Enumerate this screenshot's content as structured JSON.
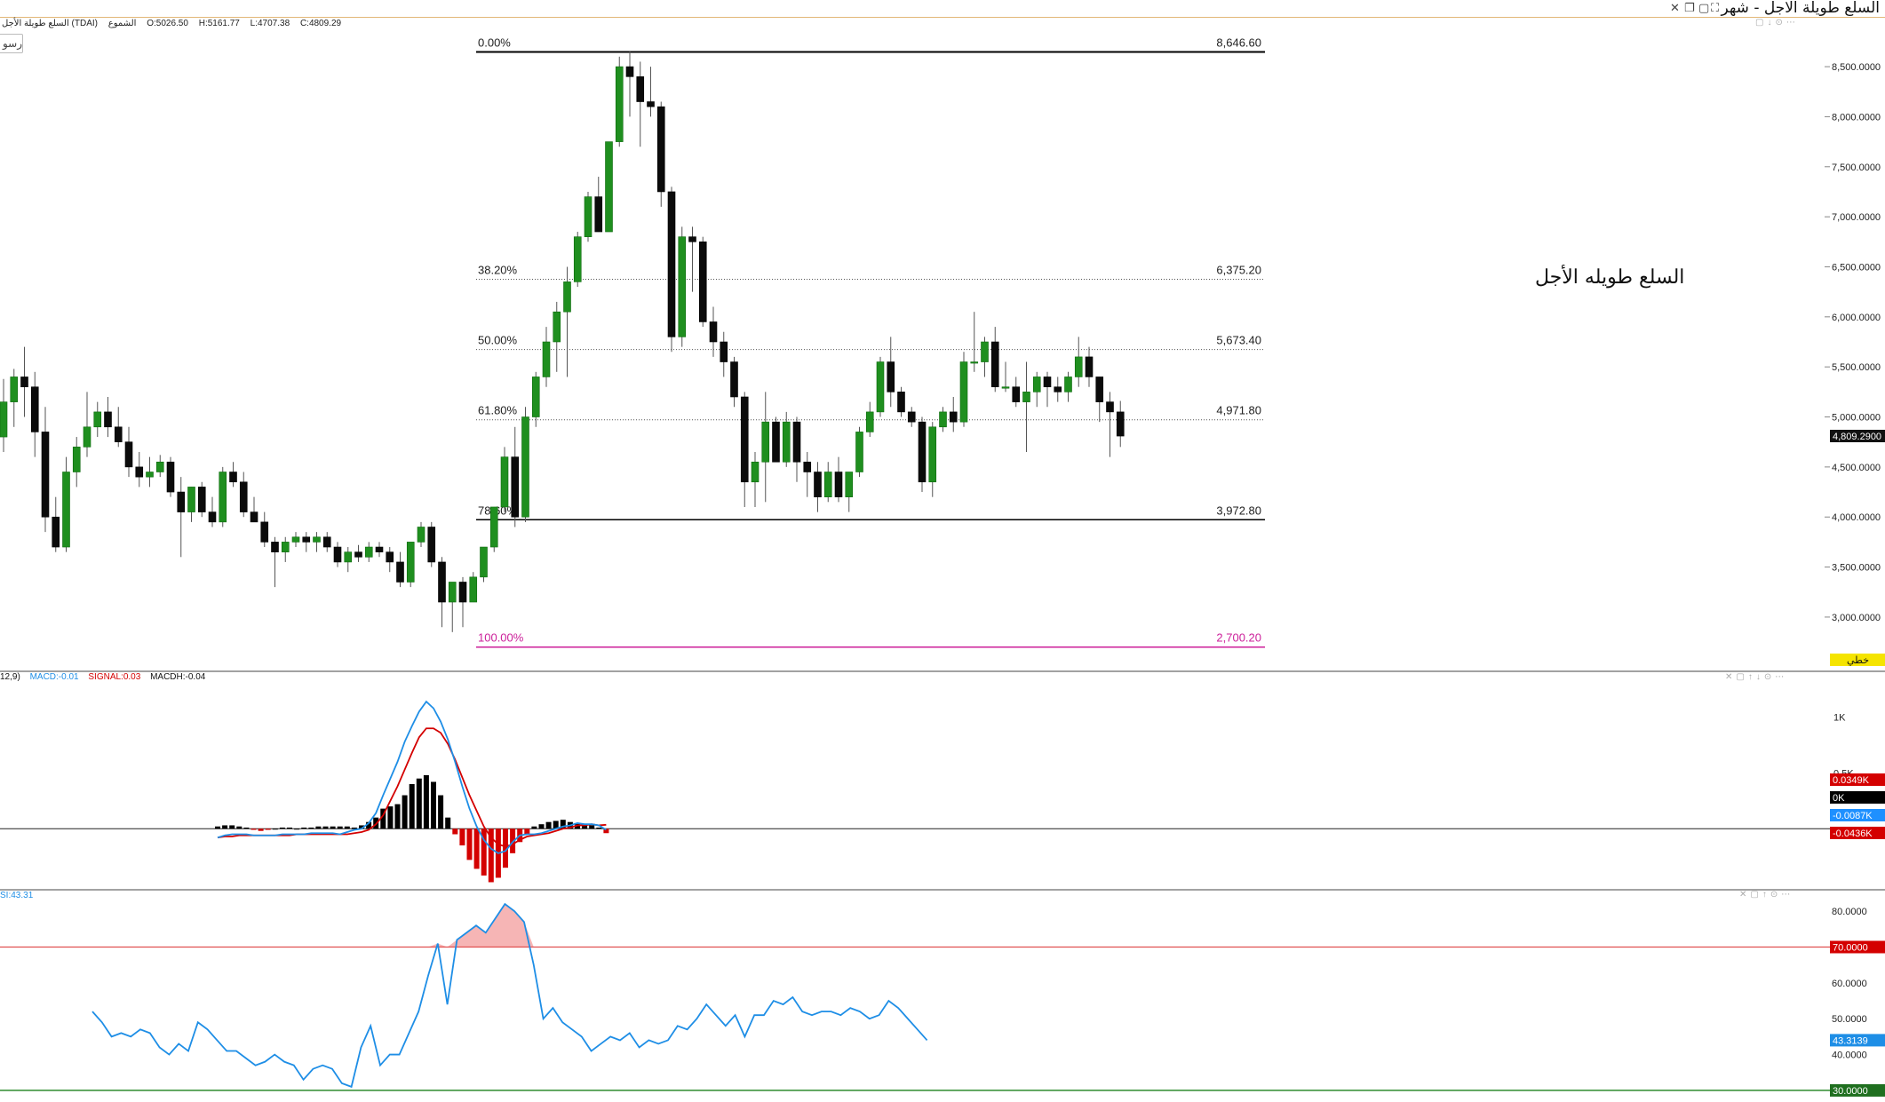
{
  "window": {
    "title": "السلع طويلة الاجل - شهر",
    "close_icon": "close-icon",
    "restore_icon": "restore-icon",
    "maximize_icon": "maximize-icon",
    "pin_icon": "pin-icon"
  },
  "ohlc": {
    "symbol": "السلع طويلة الأجل (TDAI)",
    "type": "الشموع",
    "open": "O:5026.50",
    "high": "H:5161.77",
    "low": "L:4707.38",
    "close": "C:4809.29"
  },
  "left_tab_label": "رسو",
  "note_text": "السلع طويله الأجل",
  "price_axis": {
    "ticks": [
      "8,500.0000",
      "8,000.0000",
      "7,500.0000",
      "7,000.0000",
      "6,500.0000",
      "6,000.0000",
      "5,500.0000",
      "5,000.0000",
      "4,500.0000",
      "4,000.0000",
      "3,500.0000",
      "3,000.0000"
    ],
    "last_price_label": "4,809.2900",
    "scale_badge": "خطي"
  },
  "fibonacci": {
    "levels": [
      {
        "pct": "0.00%",
        "value": "8,646.60",
        "price": 8646.6,
        "style": "solid",
        "color": "#000000"
      },
      {
        "pct": "38.20%",
        "value": "6,375.20",
        "price": 6375.2,
        "style": "dotted",
        "color": "#555555"
      },
      {
        "pct": "50.00%",
        "value": "5,673.40",
        "price": 5673.4,
        "style": "dotted",
        "color": "#555555"
      },
      {
        "pct": "61.80%",
        "value": "4,971.80",
        "price": 4971.8,
        "style": "dotted",
        "color": "#555555"
      },
      {
        "pct": "78.60%",
        "value": "3,972.80",
        "price": 3972.8,
        "style": "solid",
        "color": "#000000"
      },
      {
        "pct": "100.00%",
        "value": "2,700.20",
        "price": 2700.2,
        "style": "solid",
        "color": "#cc1f9a"
      }
    ]
  },
  "macd": {
    "legend_prefix": "12,9)",
    "macd_label": "MACD:-0.01",
    "signal_label": "SIGNAL:0.03",
    "hist_label": "MACDH:-0.04",
    "axis_ticks": [
      "1K",
      "0.5K"
    ],
    "badges": [
      {
        "text": "0.0349K",
        "color": "#d40000"
      },
      {
        "text": "0K",
        "color": "#000000"
      },
      {
        "text": "-0.0087K",
        "color": "#1e90ff"
      },
      {
        "text": "-0.0436K",
        "color": "#d40000"
      }
    ],
    "colors": {
      "macd": "#1e8ee6",
      "signal": "#d40000",
      "hist_pos": "#000000",
      "hist_neg": "#d40000"
    }
  },
  "rsi": {
    "legend_label": "SI:43.31",
    "axis_ticks": [
      "80.0000",
      "60.0000",
      "50.0000",
      "40.0000"
    ],
    "overbought_label": "70.0000",
    "oversold_label": "30.0000",
    "last_label": "43.3139",
    "colors": {
      "line": "#1e8ee6",
      "overbought": "#e05050",
      "oversold": "#2e8b2e",
      "fill": "#f4a8a8"
    }
  },
  "chart_data": [
    {
      "type": "candlestick",
      "title": "السلع طويلة الاجل - شهر",
      "xlabel": "",
      "ylabel": "",
      "ylim": [
        2600,
        8900
      ],
      "grid": false,
      "candles": [
        [
          4800,
          5380,
          4650,
          5150
        ],
        [
          5150,
          5480,
          4900,
          5400
        ],
        [
          5400,
          5700,
          5000,
          5300
        ],
        [
          5300,
          5450,
          4600,
          4850
        ],
        [
          4850,
          5100,
          3850,
          4000
        ],
        [
          4000,
          4200,
          3650,
          3700
        ],
        [
          3700,
          4600,
          3650,
          4450
        ],
        [
          4450,
          4800,
          4300,
          4700
        ],
        [
          4700,
          5250,
          4600,
          4900
        ],
        [
          4900,
          5150,
          4800,
          5050
        ],
        [
          5050,
          5200,
          4800,
          4900
        ],
        [
          4900,
          5100,
          4700,
          4750
        ],
        [
          4750,
          4900,
          4400,
          4500
        ],
        [
          4500,
          4650,
          4300,
          4400
        ],
        [
          4400,
          4600,
          4300,
          4450
        ],
        [
          4450,
          4620,
          4400,
          4550
        ],
        [
          4550,
          4600,
          4200,
          4250
        ],
        [
          4250,
          4400,
          3600,
          4050
        ],
        [
          4050,
          4300,
          3950,
          4300
        ],
        [
          4300,
          4350,
          4000,
          4050
        ],
        [
          4050,
          4200,
          3900,
          3950
        ],
        [
          3950,
          4500,
          3900,
          4450
        ],
        [
          4450,
          4550,
          4300,
          4350
        ],
        [
          4350,
          4450,
          4000,
          4050
        ],
        [
          4050,
          4200,
          3950,
          3950
        ],
        [
          3950,
          4050,
          3700,
          3750
        ],
        [
          3750,
          3800,
          3300,
          3650
        ],
        [
          3650,
          3800,
          3550,
          3750
        ],
        [
          3750,
          3850,
          3700,
          3800
        ],
        [
          3800,
          3850,
          3650,
          3750
        ],
        [
          3750,
          3850,
          3650,
          3800
        ],
        [
          3800,
          3850,
          3650,
          3700
        ],
        [
          3700,
          3750,
          3500,
          3550
        ],
        [
          3550,
          3700,
          3450,
          3650
        ],
        [
          3650,
          3720,
          3550,
          3600
        ],
        [
          3600,
          3750,
          3550,
          3700
        ],
        [
          3700,
          3750,
          3600,
          3650
        ],
        [
          3650,
          3700,
          3450,
          3550
        ],
        [
          3550,
          3650,
          3300,
          3350
        ],
        [
          3350,
          3700,
          3300,
          3750
        ],
        [
          3750,
          3950,
          3700,
          3900
        ],
        [
          3900,
          3950,
          3500,
          3550
        ],
        [
          3550,
          3600,
          2900,
          3150
        ],
        [
          3150,
          3200,
          2850,
          3350
        ],
        [
          3350,
          3400,
          2900,
          3150
        ],
        [
          3150,
          3450,
          3150,
          3400
        ],
        [
          3400,
          3700,
          3350,
          3700
        ],
        [
          3700,
          4100,
          3650,
          4100
        ],
        [
          4100,
          4700,
          4050,
          4600
        ],
        [
          4600,
          4900,
          3900,
          4000
        ],
        [
          4000,
          5100,
          3950,
          5000
        ],
        [
          5000,
          5450,
          4900,
          5400
        ],
        [
          5400,
          5900,
          5300,
          5750
        ],
        [
          5750,
          6150,
          5450,
          6050
        ],
        [
          6050,
          6500,
          5400,
          6350
        ],
        [
          6350,
          6850,
          6300,
          6800
        ],
        [
          6800,
          7250,
          6750,
          7200
        ],
        [
          7200,
          7400,
          6850,
          6850
        ],
        [
          6850,
          7600,
          6850,
          7750
        ],
        [
          7750,
          8600,
          7700,
          8500
        ],
        [
          8500,
          8650,
          8000,
          8400
        ],
        [
          8400,
          8550,
          7700,
          8150
        ],
        [
          8150,
          8500,
          8000,
          8100
        ],
        [
          8100,
          8150,
          7100,
          7250
        ],
        [
          7250,
          7300,
          5650,
          5800
        ],
        [
          5800,
          6900,
          5700,
          6800
        ],
        [
          6800,
          6900,
          6250,
          6750
        ],
        [
          6750,
          6800,
          5900,
          5950
        ],
        [
          5950,
          6100,
          5600,
          5750
        ],
        [
          5750,
          5850,
          5400,
          5550
        ],
        [
          5550,
          5600,
          5100,
          5200
        ],
        [
          5200,
          5250,
          4100,
          4350
        ],
        [
          4350,
          4650,
          4100,
          4550
        ],
        [
          4550,
          5250,
          4150,
          4950
        ],
        [
          4950,
          5000,
          4650,
          4550
        ],
        [
          4550,
          5050,
          4500,
          4950
        ],
        [
          4950,
          5000,
          4350,
          4550
        ],
        [
          4550,
          4650,
          4200,
          4450
        ],
        [
          4450,
          4550,
          4050,
          4200
        ],
        [
          4200,
          4550,
          4150,
          4450
        ],
        [
          4450,
          4600,
          4150,
          4200
        ],
        [
          4200,
          4450,
          4050,
          4450
        ],
        [
          4450,
          4900,
          4400,
          4850
        ],
        [
          4850,
          5150,
          4800,
          5050
        ],
        [
          5050,
          5600,
          5000,
          5550
        ],
        [
          5550,
          5800,
          5100,
          5250
        ],
        [
          5250,
          5300,
          5000,
          5050
        ],
        [
          5050,
          5100,
          4900,
          4950
        ],
        [
          4950,
          5000,
          4250,
          4350
        ],
        [
          4350,
          4950,
          4200,
          4900
        ],
        [
          4900,
          5100,
          4850,
          5050
        ],
        [
          5050,
          5200,
          4850,
          4950
        ],
        [
          4950,
          5650,
          4900,
          5550
        ],
        [
          5550,
          6050,
          5450,
          5550
        ],
        [
          5550,
          5800,
          5400,
          5750
        ],
        [
          5750,
          5900,
          5250,
          5300
        ],
        [
          5300,
          5550,
          5250,
          5300
        ],
        [
          5300,
          5400,
          5100,
          5150
        ],
        [
          5150,
          5550,
          4650,
          5250
        ],
        [
          5250,
          5450,
          5100,
          5400
        ],
        [
          5400,
          5450,
          5100,
          5300
        ],
        [
          5300,
          5400,
          5150,
          5250
        ],
        [
          5250,
          5450,
          5150,
          5400
        ],
        [
          5400,
          5800,
          5300,
          5600
        ],
        [
          5600,
          5700,
          5300,
          5400
        ],
        [
          5400,
          5400,
          4950,
          5150
        ],
        [
          5150,
          5250,
          4600,
          5050
        ],
        [
          5050,
          5160,
          4700,
          4809
        ]
      ]
    },
    {
      "type": "bar",
      "title": "MACD",
      "series": [
        {
          "name": "MACD",
          "values": [
            -0.08,
            -0.06,
            -0.05,
            -0.05,
            -0.05,
            -0.06,
            -0.06,
            -0.06,
            -0.06,
            -0.05,
            -0.05,
            -0.05,
            -0.05,
            -0.04,
            -0.04,
            -0.04,
            -0.04,
            -0.05,
            -0.03,
            -0.01,
            0.0,
            0.05,
            0.14,
            0.3,
            0.45,
            0.6,
            0.78,
            0.92,
            1.05,
            1.14,
            1.08,
            0.96,
            0.8,
            0.6,
            0.38,
            0.18,
            0.02,
            -0.1,
            -0.18,
            -0.22,
            -0.2,
            -0.12,
            -0.06,
            -0.05,
            -0.05,
            -0.04,
            -0.02,
            0.0,
            0.02,
            0.03,
            0.05,
            0.04,
            0.04,
            0.03,
            -0.01
          ]
        },
        {
          "name": "SIGNAL",
          "values": [
            -0.08,
            -0.07,
            -0.07,
            -0.06,
            -0.06,
            -0.06,
            -0.06,
            -0.06,
            -0.06,
            -0.06,
            -0.06,
            -0.05,
            -0.05,
            -0.05,
            -0.05,
            -0.05,
            -0.05,
            -0.05,
            -0.05,
            -0.04,
            -0.03,
            -0.01,
            0.04,
            0.12,
            0.25,
            0.38,
            0.53,
            0.68,
            0.82,
            0.9,
            0.9,
            0.86,
            0.76,
            0.62,
            0.46,
            0.3,
            0.16,
            0.02,
            -0.08,
            -0.14,
            -0.16,
            -0.14,
            -0.1,
            -0.07,
            -0.06,
            -0.05,
            -0.04,
            -0.02,
            0.0,
            0.01,
            0.03,
            0.03,
            0.04,
            0.03,
            0.035
          ]
        },
        {
          "name": "MACDH",
          "values": [
            0.02,
            0.03,
            0.03,
            0.02,
            0.01,
            -0.01,
            -0.02,
            -0.01,
            0.0,
            0.01,
            0.01,
            0.0,
            0.01,
            0.01,
            0.02,
            0.02,
            0.02,
            0.02,
            0.02,
            0.01,
            0.03,
            0.06,
            0.1,
            0.18,
            0.2,
            0.22,
            0.3,
            0.4,
            0.45,
            0.48,
            0.42,
            0.3,
            0.1,
            -0.05,
            -0.15,
            -0.28,
            -0.36,
            -0.42,
            -0.48,
            -0.44,
            -0.35,
            -0.22,
            -0.12,
            -0.05,
            0.02,
            0.04,
            0.06,
            0.07,
            0.08,
            0.06,
            0.05,
            0.04,
            0.03,
            0.01,
            -0.04
          ]
        }
      ],
      "ylim": [
        -0.5,
        1.3
      ],
      "grid": false
    },
    {
      "type": "line",
      "title": "RSI",
      "series": [
        {
          "name": "RSI",
          "values": [
            52,
            49,
            45,
            46,
            45,
            47,
            46,
            42,
            40,
            43,
            41,
            49,
            47,
            44,
            41,
            41,
            39,
            37,
            38,
            40,
            38,
            37,
            33,
            36,
            37,
            36,
            32,
            31,
            42,
            48,
            37,
            40,
            40,
            46,
            52,
            62,
            71,
            54,
            72,
            74,
            76,
            74,
            78,
            82,
            80,
            77,
            65,
            50,
            53,
            49,
            47,
            45,
            41,
            43,
            45,
            44,
            46,
            42,
            44,
            43,
            44,
            48,
            47,
            50,
            54,
            51,
            48,
            51,
            45,
            51,
            51,
            55,
            54,
            56,
            52,
            51,
            52,
            52,
            51,
            53,
            52,
            50,
            51,
            55,
            53,
            50,
            47,
            44
          ]
        }
      ],
      "ylim": [
        28,
        84
      ],
      "grid": false
    }
  ]
}
